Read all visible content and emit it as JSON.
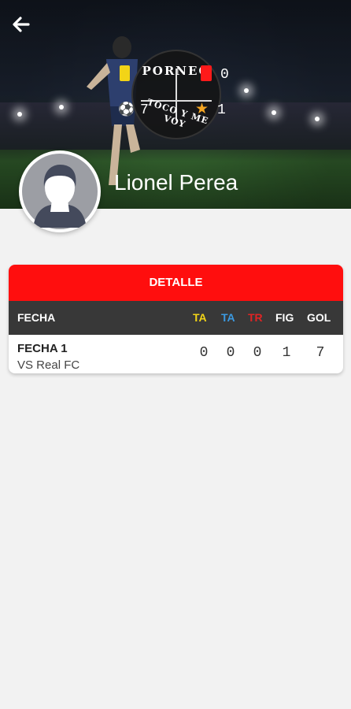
{
  "header": {
    "player_name": "Lionel Perea",
    "logo_top_text": "PORNEO",
    "logo_bottom_text": "TOCO Y ME VOY",
    "stats": {
      "yellow_cards": "",
      "red_cards": "0",
      "goals": "7",
      "mvp": "1"
    }
  },
  "detail": {
    "title": "DETALLE",
    "columns": [
      "FECHA",
      "TA",
      "TA",
      "TR",
      "FIG",
      "GOL"
    ],
    "column_colors": [
      "#ffffff",
      "#f2d417",
      "#3b9ae1",
      "#e02424",
      "#ffffff",
      "#ffffff"
    ],
    "rows": [
      {
        "title": "FECHA 1",
        "subtitle": "VS Real FC",
        "values": [
          "0",
          "0",
          "0",
          "1",
          "7"
        ]
      }
    ]
  },
  "colors": {
    "accent": "#ff0e0e",
    "table_header": "#383838",
    "background": "#f2f2f2"
  },
  "icons": [
    "back-arrow-icon",
    "yellow-card-icon",
    "red-card-icon",
    "soccer-ball-icon",
    "star-icon",
    "avatar-icon"
  ]
}
